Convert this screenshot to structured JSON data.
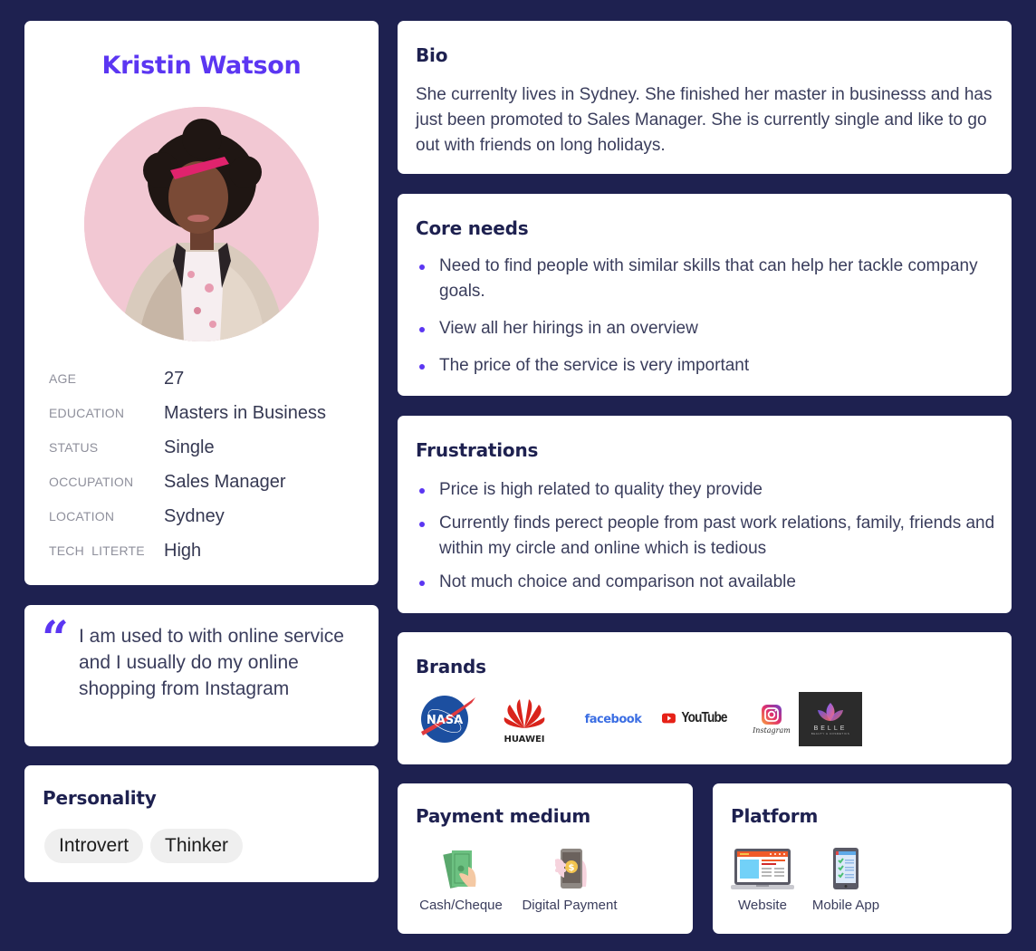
{
  "profile": {
    "name": "Kristin Watson",
    "photo_alt": "profile-photo",
    "attributes": [
      {
        "key": "AGE",
        "value": "27"
      },
      {
        "key": "EDUCATION",
        "value": "Masters in Business"
      },
      {
        "key": "STATUS",
        "value": "Single"
      },
      {
        "key": "OCCUPATION",
        "value": "Sales Manager"
      },
      {
        "key": "LOCATION",
        "value": "Sydney"
      },
      {
        "key": "TECH  LITERTE",
        "value": "High"
      }
    ]
  },
  "quote": {
    "mark": "“",
    "text": "I am used to with online service and I usually do my online shopping from Instagram"
  },
  "personality": {
    "title": "Personality",
    "tags": [
      "Introvert",
      "Thinker"
    ]
  },
  "bio": {
    "title": "Bio",
    "text": "She currenlty lives in Sydney. She finished her master in businesss and has just been promoted to Sales Manager. She is currently single and like to go out with friends on long holidays."
  },
  "core_needs": {
    "title": "Core needs",
    "items": [
      "Need to find people with similar skills that can help her tackle company goals.",
      "View all her hirings in an overview",
      "The price of the service is very important"
    ]
  },
  "frustrations": {
    "title": "Frustrations",
    "items": [
      "Price is high related to quality they provide",
      "Currently finds perect people from past work relations, family, friends and within my circle and online which is tedious",
      "Not much choice and comparison not available"
    ]
  },
  "brands": {
    "title": "Brands",
    "logos": [
      {
        "name": "NASA",
        "text": "NASA"
      },
      {
        "name": "Huawei",
        "text": "HUAWEI"
      },
      {
        "name": "Facebook",
        "text": "facebook"
      },
      {
        "name": "YouTube",
        "text": "YouTube"
      },
      {
        "name": "Instagram",
        "text": "Instagram"
      },
      {
        "name": "Belle",
        "text": "BELLE",
        "subtext": "BEAUTY & COSMETICS"
      }
    ]
  },
  "payment": {
    "title": "Payment medium",
    "options": [
      {
        "label": "Cash/Cheque",
        "icon": "cash-icon"
      },
      {
        "label": "Digital Payment",
        "icon": "digital-payment-icon"
      }
    ]
  },
  "platform": {
    "title": "Platform",
    "options": [
      {
        "label": "Website",
        "icon": "website-icon"
      },
      {
        "label": "Mobile App",
        "icon": "mobile-app-icon"
      }
    ]
  },
  "colors": {
    "background": "#1e2150",
    "accent": "#5b36f2",
    "heading": "#1e2150",
    "text": "#3a3d5c"
  }
}
